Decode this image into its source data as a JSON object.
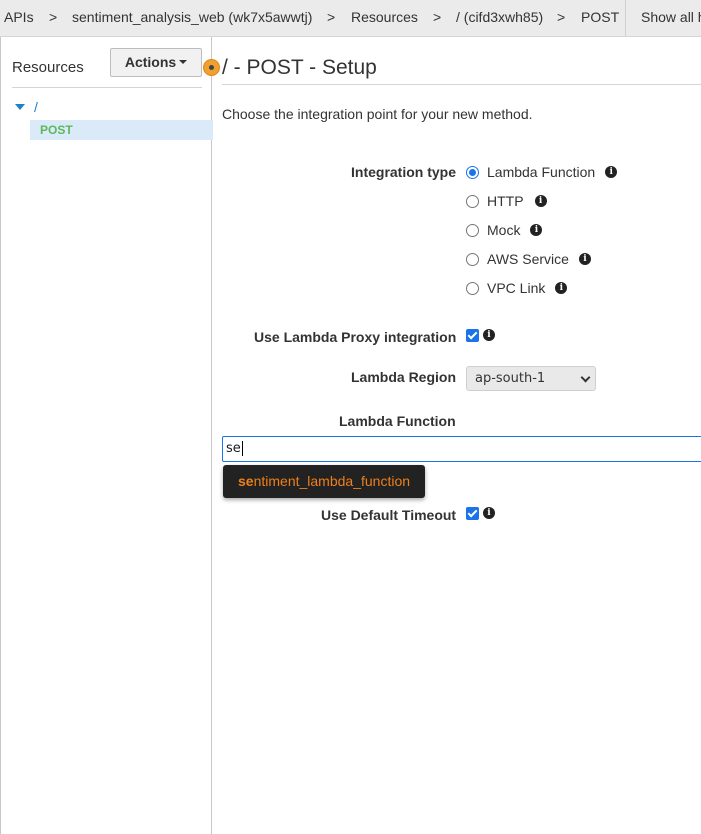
{
  "breadcrumb": {
    "items": [
      "APIs",
      "sentiment_analysis_web (wk7x5awwtj)",
      "Resources",
      "/ (cifd3xwh85)",
      "POST"
    ],
    "separator": ">",
    "show_all": "Show all h"
  },
  "sidebar": {
    "title": "Resources",
    "actions_label": "Actions",
    "tree": {
      "root": "/",
      "child": "POST"
    }
  },
  "main": {
    "title": "/ - POST - Setup",
    "intro": "Choose the integration point for your new method.",
    "integration_type": {
      "label": "Integration type",
      "selected": "Lambda Function",
      "options": [
        "Lambda Function",
        "HTTP",
        "Mock",
        "AWS Service",
        "VPC Link"
      ]
    },
    "proxy": {
      "label": "Use Lambda Proxy integration",
      "checked": true
    },
    "region": {
      "label": "Lambda Region",
      "value": "ap-south-1"
    },
    "function": {
      "label": "Lambda Function",
      "value": "se",
      "suggestion_match": "se",
      "suggestion_rest": "ntiment_lambda_function"
    },
    "timeout": {
      "label": "Use Default Timeout",
      "checked": true
    }
  },
  "colors": {
    "accent": "#1a73e8",
    "highlight": "#ef7f1a",
    "tree_selected_bg": "#dbeaf8",
    "method_green": "#5cb85c"
  },
  "icons": {
    "info": "info-icon",
    "caret": "caret-down-icon"
  }
}
